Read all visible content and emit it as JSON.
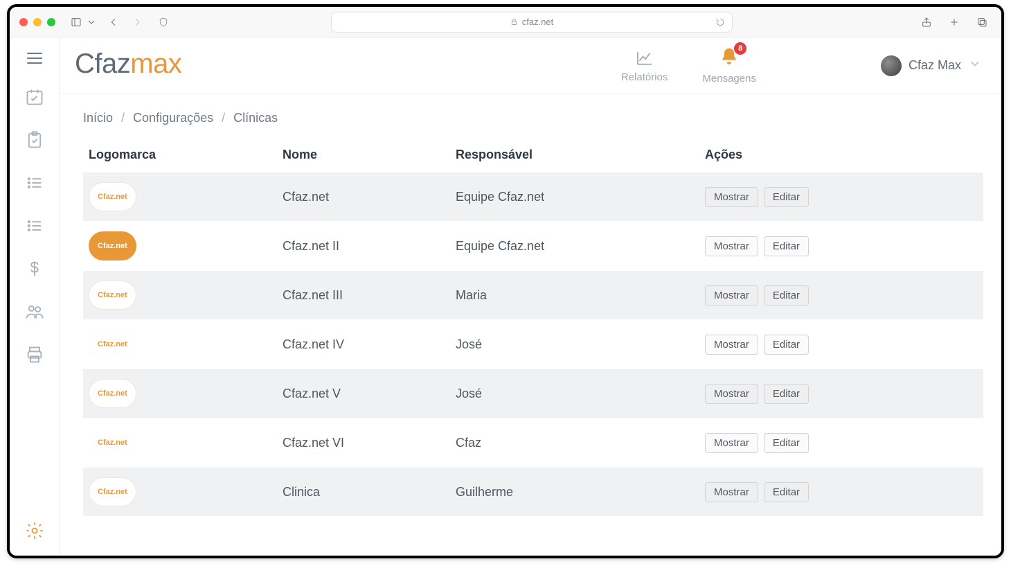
{
  "browser": {
    "url": "cfaz.net"
  },
  "logo": {
    "part1": "Cfaz",
    "part2": "max"
  },
  "header": {
    "reports_label": "Relatórios",
    "messages_label": "Mensagens",
    "badge_count": "8",
    "user_name": "Cfaz Max"
  },
  "breadcrumbs": {
    "home": "Início",
    "settings": "Configurações",
    "current": "Clínicas"
  },
  "table": {
    "headers": {
      "logo": "Logomarca",
      "name": "Nome",
      "resp": "Responsável",
      "actions": "Ações"
    },
    "action_show": "Mostrar",
    "action_edit": "Editar",
    "rows": [
      {
        "name": "Cfaz.net",
        "resp": "Equipe Cfaz.net",
        "logo_label": "Cfaz.net",
        "logo_style": "cloud"
      },
      {
        "name": "Cfaz.net II",
        "resp": "Equipe Cfaz.net",
        "logo_label": "Cfaz.net",
        "logo_style": "orange"
      },
      {
        "name": "Cfaz.net III",
        "resp": "Maria",
        "logo_label": "Cfaz.net",
        "logo_style": "cloud"
      },
      {
        "name": "Cfaz.net IV",
        "resp": "José",
        "logo_label": "Cfaz.net",
        "logo_style": "flat"
      },
      {
        "name": "Cfaz.net V",
        "resp": "José",
        "logo_label": "Cfaz.net",
        "logo_style": "cloud"
      },
      {
        "name": "Cfaz.net VI",
        "resp": "Cfaz",
        "logo_label": "Cfaz.net",
        "logo_style": "flat"
      },
      {
        "name": "Clinica",
        "resp": "Guilherme",
        "logo_label": "Cfaz.net",
        "logo_style": "cloud"
      }
    ]
  }
}
